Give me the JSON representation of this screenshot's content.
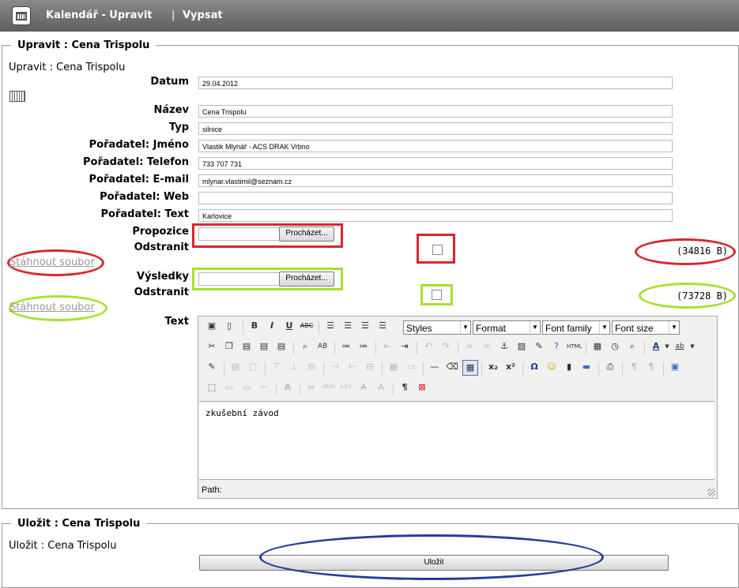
{
  "header": {
    "title": "Kalendář - Upravit",
    "separator": "|",
    "link": "Vypsat"
  },
  "edit_section": {
    "legend": "Upravit : Cena Trispolu",
    "subtitle": "Upravit : Cena Trispolu",
    "fields": {
      "datum": {
        "label": "Datum",
        "value": "29.04.2012"
      },
      "nazev": {
        "label": "Název",
        "value": "Cena Trispolu"
      },
      "typ": {
        "label": "Typ",
        "value": "silnice"
      },
      "jmeno": {
        "label": "Pořadatel: Jméno",
        "value": "Vlastik Mlynář - ACS DRAK Vrbno"
      },
      "telefon": {
        "label": "Pořadatel: Telefon",
        "value": "733 707 731"
      },
      "email": {
        "label": "Pořadatel: E-mail",
        "value": "mlynar.vlastimil@seznam.cz"
      },
      "web": {
        "label": "Pořadatel: Web",
        "value": ""
      },
      "text_org": {
        "label": "Pořadatel: Text",
        "value": "Karlovice"
      }
    },
    "propozice": {
      "label": "Propozice",
      "remove_label": "Odstranit",
      "browse": "Procházet...",
      "download": "Stáhnout soubor",
      "size": "(34816 B)"
    },
    "vysledky": {
      "label": "Výsledky",
      "remove_label": "Odstranit",
      "browse": "Procházet...",
      "download": "Stáhnout soubor",
      "size": "(73728 B)"
    },
    "text_label": "Text",
    "editor": {
      "selects": {
        "styles": "Styles",
        "format": "Format",
        "font_family": "Font family",
        "font_size": "Font size"
      },
      "content": "zkušební závod",
      "path": "Path:"
    }
  },
  "save_section": {
    "legend": "Uložit : Cena Trispolu",
    "subtitle": "Uložit : Cena Trispolu",
    "button": "Uložit"
  },
  "colors": {
    "red": "#d8262e",
    "green": "#a8e02c",
    "blue": "#243c9c",
    "header": "#6e6e6e"
  }
}
